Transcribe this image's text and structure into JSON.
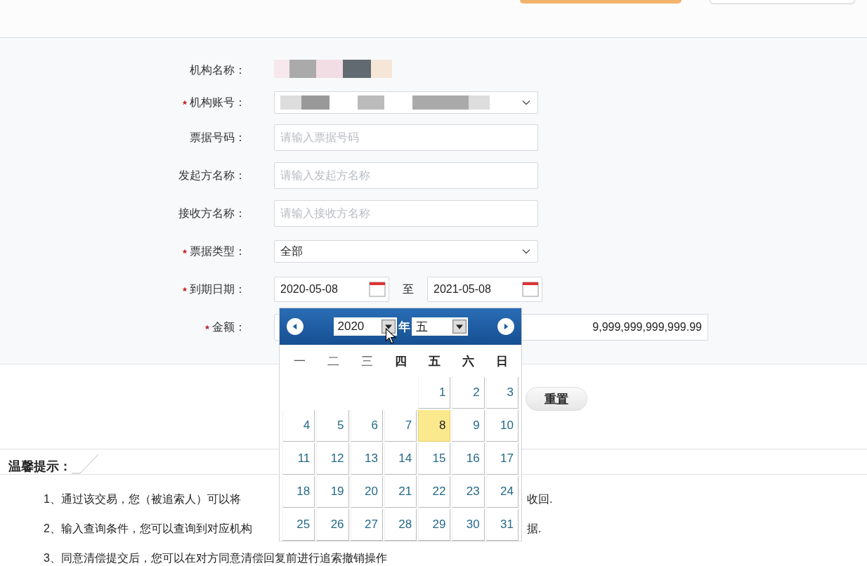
{
  "form": {
    "rows": [
      {
        "label": "机构名称：",
        "required": false,
        "kind": "redacted_text"
      },
      {
        "label": "机构账号：",
        "required": true,
        "kind": "redacted_select"
      },
      {
        "label": "票据号码：",
        "required": false,
        "kind": "text",
        "placeholder": "请输入票据号码"
      },
      {
        "label": "发起方名称：",
        "required": false,
        "kind": "text",
        "placeholder": "请输入发起方名称"
      },
      {
        "label": "接收方名称：",
        "required": false,
        "kind": "text",
        "placeholder": "请输入接收方名称"
      },
      {
        "label": "票据类型：",
        "required": true,
        "kind": "select",
        "value": "全部"
      },
      {
        "label": "到期日期：",
        "required": true,
        "kind": "date_range",
        "from": "2020-05-08",
        "separator": "至",
        "to": "2021-05-08"
      },
      {
        "label": "金额：",
        "required": true,
        "kind": "amount",
        "value": "9,999,999,999,999.99"
      }
    ]
  },
  "buttons": [
    {
      "label": "重置"
    }
  ],
  "tips": {
    "title": "温馨提示：",
    "lines": [
      "1、通过该交易，您（被追索人）可以将",
      "2、输入查询条件，您可以查询到对应机构",
      "3、同意清偿提交后，您可以在对方同意清偿回复前进行追索撤销操作"
    ],
    "line_ends": [
      "收回.",
      "据."
    ]
  },
  "calendar": {
    "year": "2020",
    "year_label": "年",
    "month": "五",
    "weekdays": [
      "一",
      "二",
      "三",
      "四",
      "五",
      "六",
      "日"
    ],
    "weeks": [
      [
        {
          "day": "1",
          "selected": false
        },
        {
          "day": "2",
          "selected": false
        },
        {
          "day": "3",
          "selected": false
        }
      ],
      [
        {
          "day": "4",
          "selected": false
        },
        {
          "day": "5",
          "selected": false
        },
        {
          "day": "6",
          "selected": false
        },
        {
          "day": "7",
          "selected": false
        },
        {
          "day": "8",
          "selected": true
        },
        {
          "day": "9",
          "selected": false
        },
        {
          "day": "10",
          "selected": false
        }
      ],
      [
        {
          "day": "11",
          "selected": false
        },
        {
          "day": "12",
          "selected": false
        },
        {
          "day": "13",
          "selected": false
        },
        {
          "day": "14",
          "selected": false
        },
        {
          "day": "15",
          "selected": false
        },
        {
          "day": "16",
          "selected": false
        },
        {
          "day": "17",
          "selected": false
        }
      ],
      [
        {
          "day": "18",
          "selected": false
        },
        {
          "day": "19",
          "selected": false
        },
        {
          "day": "20",
          "selected": false
        },
        {
          "day": "21",
          "selected": false
        },
        {
          "day": "22",
          "selected": false
        },
        {
          "day": "23",
          "selected": false
        },
        {
          "day": "24",
          "selected": false
        }
      ],
      [
        {
          "day": "25",
          "selected": false
        },
        {
          "day": "26",
          "selected": false
        },
        {
          "day": "27",
          "selected": false
        },
        {
          "day": "28",
          "selected": false
        },
        {
          "day": "29",
          "selected": false
        },
        {
          "day": "30",
          "selected": false
        },
        {
          "day": "31",
          "selected": false
        }
      ]
    ]
  }
}
